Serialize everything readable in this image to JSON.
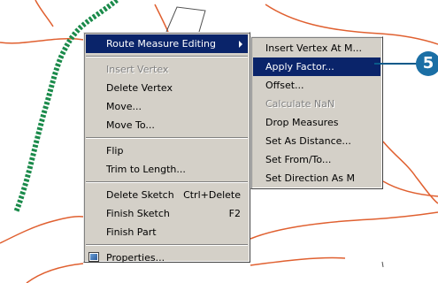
{
  "main_menu": {
    "route_measure_editing": "Route Measure Editing",
    "insert_vertex": "Insert Vertex",
    "delete_vertex": "Delete Vertex",
    "move": "Move...",
    "move_to": "Move To...",
    "flip": "Flip",
    "trim_to_length": "Trim to Length...",
    "delete_sketch": "Delete Sketch",
    "delete_sketch_shortcut": "Ctrl+Delete",
    "finish_sketch": "Finish Sketch",
    "finish_sketch_shortcut": "F2",
    "finish_part": "Finish Part",
    "properties": "Properties..."
  },
  "sub_menu": {
    "insert_vertex_at_m": "Insert Vertex At M...",
    "apply_factor": "Apply Factor...",
    "offset": "Offset...",
    "calculate_nan": "Calculate NaN",
    "drop_measures": "Drop Measures",
    "set_as_distance": "Set As Distance...",
    "set_from_to": "Set From/To...",
    "set_direction_as_m": "Set Direction As M"
  },
  "callout": {
    "number": "5"
  },
  "colors": {
    "menu_bg": "#d4d0c8",
    "highlight": "#0a246a",
    "route_line": "#1a8a4a",
    "map_lines": "#e06030",
    "callout": "#1b6fa5"
  },
  "icons": {
    "properties": "properties-icon",
    "submenu": "chevron-right-icon"
  }
}
